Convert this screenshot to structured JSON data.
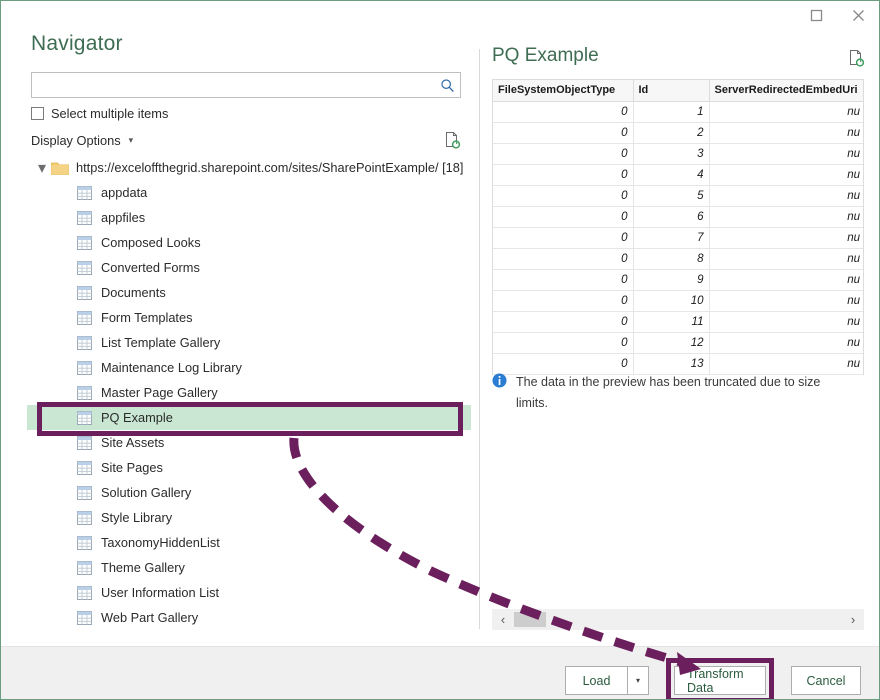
{
  "window": {
    "title": "Navigator",
    "maximize_icon": "maximize-icon",
    "close_icon": "close-icon"
  },
  "colors": {
    "window_border": "#6a9e7e",
    "heading_green": "#3f6d53",
    "annotation_purple": "#6b1f5c",
    "selection_green": "#c9e7d2",
    "info_blue": "#2b7cd3",
    "folder_yellow": "#f5ce7a"
  },
  "search": {
    "value": "",
    "placeholder": "",
    "icon": "search-icon"
  },
  "options": {
    "select_multiple_label": "Select multiple items",
    "select_multiple_checked": false,
    "display_options_label": "Display Options",
    "display_options_caret": "▾",
    "refresh_icon": "refresh-page-icon"
  },
  "tree": {
    "root": {
      "label": "https://exceloffthegrid.sharepoint.com/sites/SharePointExample/ [18]",
      "expander": "▾",
      "icon": "folder-icon",
      "expanded": true
    },
    "items": [
      {
        "label": "appdata",
        "icon": "table-icon",
        "selected": false
      },
      {
        "label": "appfiles",
        "icon": "table-icon",
        "selected": false
      },
      {
        "label": "Composed Looks",
        "icon": "table-icon",
        "selected": false
      },
      {
        "label": "Converted Forms",
        "icon": "table-icon",
        "selected": false
      },
      {
        "label": "Documents",
        "icon": "table-icon",
        "selected": false
      },
      {
        "label": "Form Templates",
        "icon": "table-icon",
        "selected": false
      },
      {
        "label": "List Template Gallery",
        "icon": "table-icon",
        "selected": false
      },
      {
        "label": "Maintenance Log Library",
        "icon": "table-icon",
        "selected": false
      },
      {
        "label": "Master Page Gallery",
        "icon": "table-icon",
        "selected": false
      },
      {
        "label": "PQ Example",
        "icon": "table-icon",
        "selected": true
      },
      {
        "label": "Site Assets",
        "icon": "table-icon",
        "selected": false
      },
      {
        "label": "Site Pages",
        "icon": "table-icon",
        "selected": false
      },
      {
        "label": "Solution Gallery",
        "icon": "table-icon",
        "selected": false
      },
      {
        "label": "Style Library",
        "icon": "table-icon",
        "selected": false
      },
      {
        "label": "TaxonomyHiddenList",
        "icon": "table-icon",
        "selected": false
      },
      {
        "label": "Theme Gallery",
        "icon": "table-icon",
        "selected": false
      },
      {
        "label": "User Information List",
        "icon": "table-icon",
        "selected": false
      },
      {
        "label": "Web Part Gallery",
        "icon": "table-icon",
        "selected": false
      }
    ]
  },
  "preview": {
    "title": "PQ Example",
    "refresh_icon": "refresh-page-icon",
    "columns": [
      "FileSystemObjectType",
      "Id",
      "ServerRedirectedEmbedUri"
    ],
    "rows": [
      [
        "0",
        "1",
        "nu"
      ],
      [
        "0",
        "2",
        "nu"
      ],
      [
        "0",
        "3",
        "nu"
      ],
      [
        "0",
        "4",
        "nu"
      ],
      [
        "0",
        "5",
        "nu"
      ],
      [
        "0",
        "6",
        "nu"
      ],
      [
        "0",
        "7",
        "nu"
      ],
      [
        "0",
        "8",
        "nu"
      ],
      [
        "0",
        "9",
        "nu"
      ],
      [
        "0",
        "10",
        "nu"
      ],
      [
        "0",
        "11",
        "nu"
      ],
      [
        "0",
        "12",
        "nu"
      ],
      [
        "0",
        "13",
        "nu"
      ]
    ],
    "truncation_notice": "The data in the preview has been truncated due to size limits.",
    "info_icon": "info-icon",
    "scrollbar": {
      "left_arrow": "‹",
      "right_arrow": "›"
    }
  },
  "footer": {
    "load_label": "Load",
    "load_split_caret": "▾",
    "transform_label": "Transform Data",
    "cancel_label": "Cancel"
  },
  "annotations": {
    "highlight_target": "PQ Example",
    "arrow_from": "PQ Example",
    "arrow_to": "Transform Data"
  }
}
